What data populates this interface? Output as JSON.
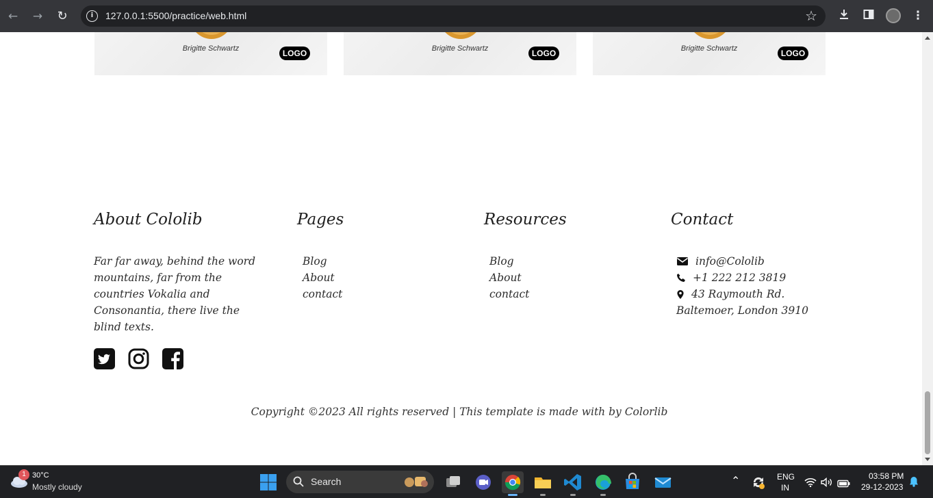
{
  "browser": {
    "url": "127.0.0.1:5500/practice/web.html"
  },
  "cards": [
    {
      "name": "Brigitte Schwartz",
      "logo": "LOGO"
    },
    {
      "name": "Brigitte Schwartz",
      "logo": "LOGO"
    },
    {
      "name": "Brigitte Schwartz",
      "logo": "LOGO"
    }
  ],
  "footer": {
    "about": {
      "heading": "About Cololib",
      "lines": [
        "Far far away, behind the word",
        "mountains, far from the",
        "countries Vokalia and",
        "Consonantia, there live the",
        "blind texts."
      ]
    },
    "social": [
      "twitter-icon",
      "instagram-icon",
      "facebook-icon"
    ],
    "pages": {
      "heading": "Pages",
      "links": [
        "Blog",
        "About",
        "contact"
      ]
    },
    "resources": {
      "heading": "Resources",
      "links": [
        "Blog",
        "About",
        "contact"
      ]
    },
    "contact": {
      "heading": "Contact",
      "email": "info@Cololib",
      "phone": "+1 222 212 3819",
      "address_line1": "43 Raymouth Rd.",
      "address_line2": "Baltemoer, London 3910"
    },
    "copyright": "Copyright ©2023 All rights reserved | This template is made with by Colorlib"
  },
  "taskbar": {
    "weather_badge": "1",
    "weather_temp": "30°C",
    "weather_desc": "Mostly cloudy",
    "search_label": "Search",
    "lang_top": "ENG",
    "lang_bottom": "IN",
    "time": "03:58 PM",
    "date": "29-12-2023"
  }
}
